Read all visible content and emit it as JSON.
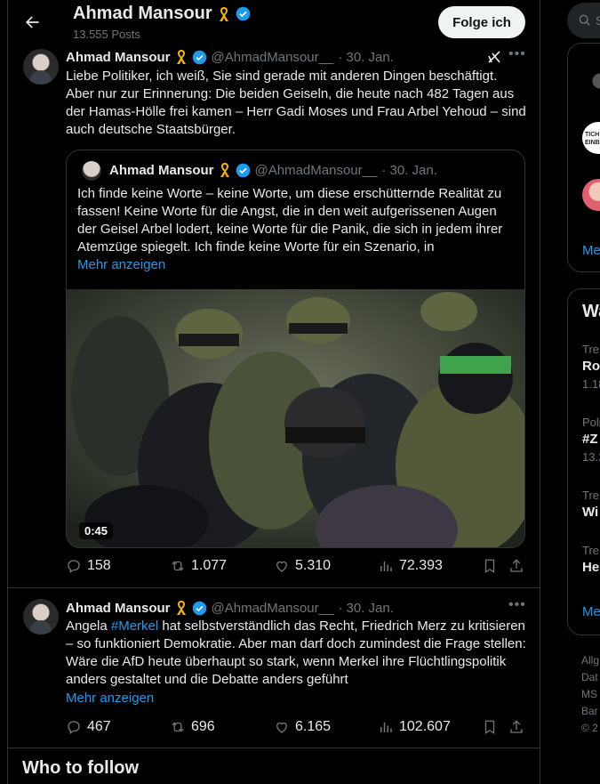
{
  "header": {
    "name": "Ahmad Mansour",
    "posts": "13.555 Posts",
    "follow_label": "Folge ich"
  },
  "tweet1": {
    "name": "Ahmad Mansour",
    "handle": "@AhmadMansour__",
    "date": "· 30. Jan.",
    "text": "Liebe Politiker, ich weiß, Sie sind gerade mit anderen Dingen beschäftigt. Aber nur zur Erinnerung: Die beiden Geiseln, die heute nach 482 Tagen aus der Hamas-Hölle frei kamen – Herr Gadi Moses und Frau Arbel Yehoud – sind auch deutsche Staatsbürger.",
    "quote": {
      "name": "Ahmad Mansour",
      "handle": "@AhmadMansour__",
      "date": "· 30. Jan.",
      "text": "Ich finde keine Worte – keine Worte, um diese erschütternde Realität zu fassen! Keine Worte für die Angst, die in den weit aufgerissenen Augen der Geisel Arbel lodert, keine Worte für die Panik, die sich in jedem ihrer Atemzüge spiegelt. Ich finde keine Worte für ein Szenario, in",
      "more": "Mehr anzeigen",
      "video_duration": "0:45"
    },
    "replies": "158",
    "reposts": "1.077",
    "likes": "5.310",
    "views": "72.393"
  },
  "tweet2": {
    "name": "Ahmad Mansour",
    "handle": "@AhmadMansour__",
    "date": "· 30. Jan.",
    "text_before": "Angela ",
    "hashtag": "#Merkel",
    "text_after": " hat selbstverständlich das Recht, Friedrich Merz zu kritisieren – so funktioniert Demokratie. Aber man darf doch zumindest die Frage stellen: Wäre die AfD heute überhaupt so stark, wenn Merkel ihre Flüchtlingspolitik anders gestaltet und die Debatte anders geführt",
    "more": "Mehr anzeigen",
    "replies": "467",
    "reposts": "696",
    "likes": "6.165",
    "views": "102.607"
  },
  "who_to_follow": "Who to follow",
  "sidebar": {
    "search_placeholder": "S",
    "more1": "Me",
    "what_heading": "Wa",
    "trends": [
      {
        "meta": "Tren",
        "title": "Ro",
        "count": "1.18"
      },
      {
        "meta": "Poli",
        "title": "#Z",
        "count": "13.2"
      },
      {
        "meta": "Tren",
        "title": "Wi",
        "count": ""
      },
      {
        "meta": "Tren",
        "title": "He",
        "count": ""
      }
    ],
    "more2": "Me",
    "footer": [
      "Allg",
      "Dat",
      "MS",
      "Bar",
      "© 2"
    ],
    "card_text": "TICH EINB"
  },
  "colors": {
    "accent": "#1d9bf0",
    "bg": "#000000",
    "border": "#2f3336",
    "muted": "#71767b"
  }
}
